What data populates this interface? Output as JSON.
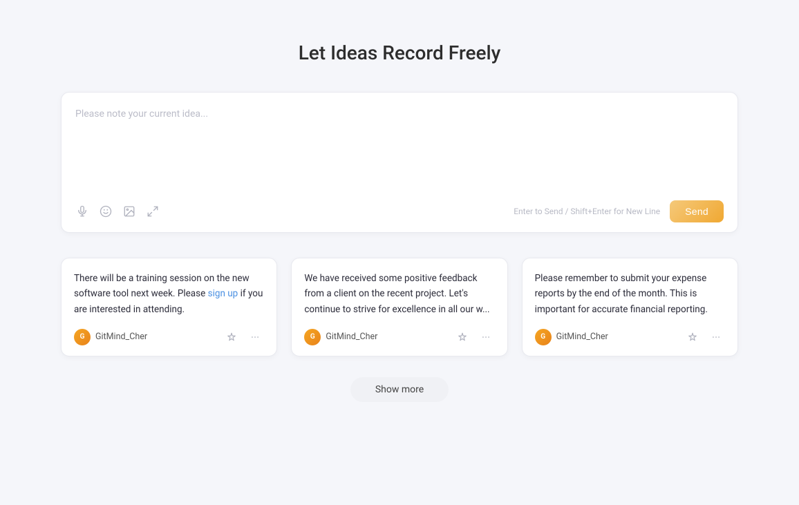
{
  "page": {
    "title": "Let Ideas Record Freely"
  },
  "input_area": {
    "placeholder": "Please note your current idea...",
    "hint": "Enter to Send / Shift+Enter for New Line",
    "send_label": "Send",
    "icons": {
      "mic": "microphone-icon",
      "emoji": "emoji-icon",
      "image": "image-icon",
      "expand": "expand-icon"
    }
  },
  "cards": [
    {
      "id": 1,
      "text": "There will be a training session on the new software tool next week. Please sign up if you are interested in attending.",
      "highlight_text": "sign up",
      "author": "GitMind_Cher"
    },
    {
      "id": 2,
      "text": "We have received some positive feedback from a client on the recent project. Let's continue to strive for excellence in all our w...",
      "author": "GitMind_Cher"
    },
    {
      "id": 3,
      "text": "Please remember to submit your expense reports by the end of the month. This is important for accurate financial reporting.",
      "author": "GitMind_Cher"
    }
  ],
  "show_more": {
    "label": "Show more"
  },
  "colors": {
    "accent_orange": "#f0a832",
    "link_blue": "#4a90e2"
  }
}
